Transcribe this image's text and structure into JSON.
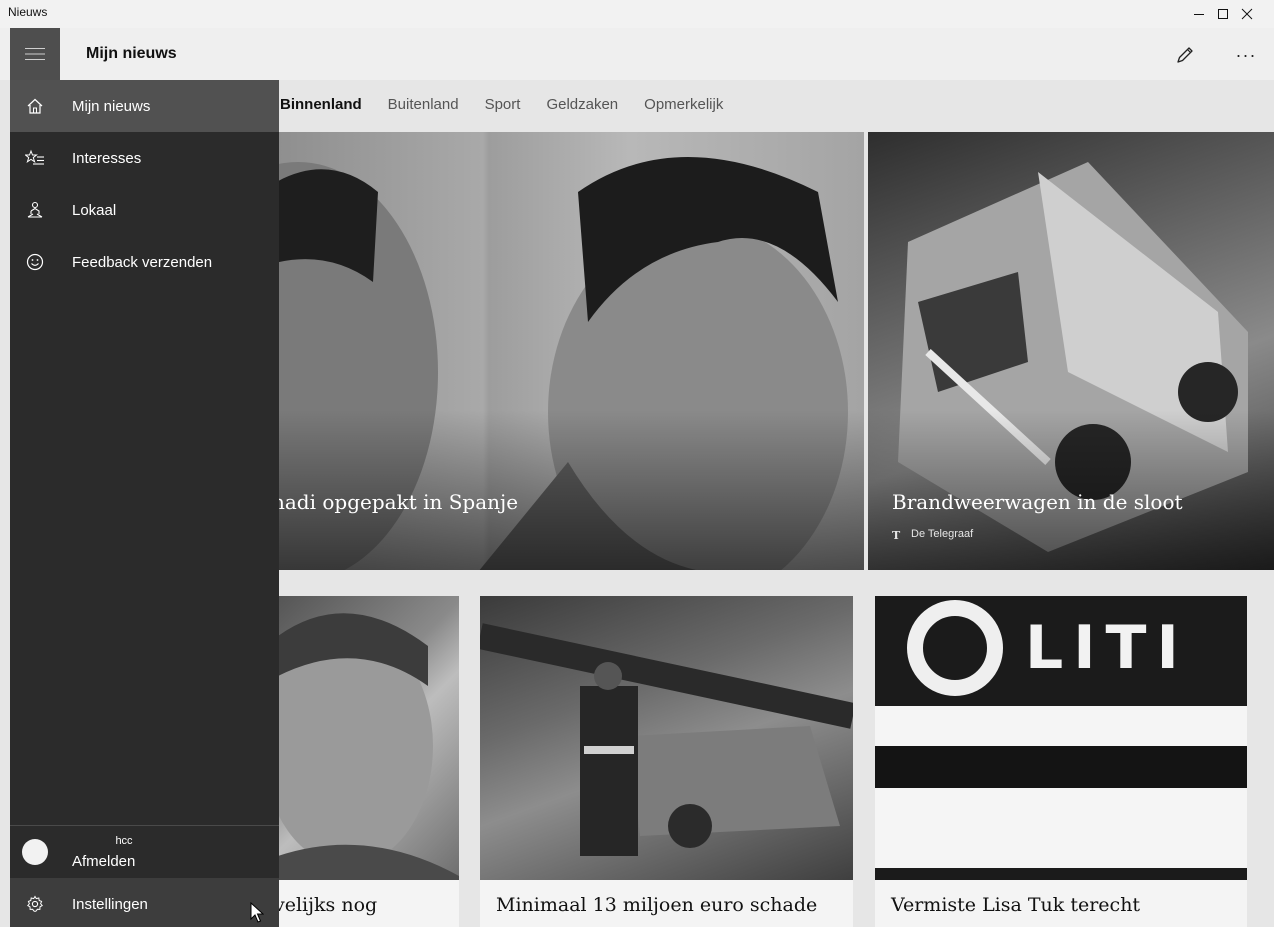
{
  "window": {
    "title": "Nieuws",
    "controls": {
      "minimize_icon": "minimize-icon",
      "maximize_icon": "maximize-icon",
      "close_icon": "close-icon"
    }
  },
  "header": {
    "title": "Mijn nieuws",
    "menu_icon": "hamburger-icon",
    "edit_icon": "pencil-icon",
    "more_label": "···"
  },
  "tabs": [
    {
      "label": "Binnenland",
      "active": true
    },
    {
      "label": "Buitenland",
      "active": false
    },
    {
      "label": "Sport",
      "active": false
    },
    {
      "label": "Geldzaken",
      "active": false
    },
    {
      "label": "Opmerkelijk",
      "active": false
    }
  ],
  "hero": [
    {
      "title": "hadi opgepakt in Spanje"
    },
    {
      "title": "Brandweerwagen in de sloot",
      "source": "De Telegraaf"
    }
  ],
  "cards": [
    {
      "title": "velijks nog"
    },
    {
      "title": "Minimaal 13 miljoen euro schade"
    },
    {
      "title": "Vermiste Lisa Tuk terecht",
      "image_text": "LITI"
    }
  ],
  "sidebar": {
    "items": [
      {
        "label": "Mijn nieuws",
        "icon": "home-icon",
        "selected": true
      },
      {
        "label": "Interesses",
        "icon": "star-list-icon",
        "selected": false
      },
      {
        "label": "Lokaal",
        "icon": "person-location-icon",
        "selected": false
      },
      {
        "label": "Feedback verzenden",
        "icon": "smiley-icon",
        "selected": false
      }
    ],
    "account": {
      "user": "hcc",
      "signout_label": "Afmelden"
    },
    "settings": {
      "label": "Instellingen",
      "icon": "gear-icon"
    }
  },
  "colors": {
    "sidebar_bg": "#2b2b2b",
    "sidebar_selected": "#515151",
    "content_bg": "#e6e6e6"
  }
}
